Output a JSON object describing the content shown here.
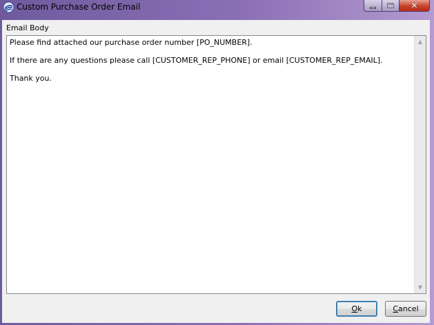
{
  "window": {
    "title": "Custom Purchase Order Email",
    "app_icon": "swirl-logo-icon",
    "minimize_icon": "minimize-icon",
    "maximize_icon": "maximize-icon",
    "close_icon": "close-icon",
    "close_glyph": "✕"
  },
  "email": {
    "label": "Email Body",
    "body": "Please find attached our purchase order number [PO_NUMBER].\n\nIf there are any questions please call [CUSTOMER_REP_PHONE] or email [CUSTOMER_REP_EMAIL].\n\nThank you."
  },
  "scrollbar": {
    "up_glyph": "▲",
    "down_glyph": "▼"
  },
  "buttons": {
    "ok_accel": "O",
    "ok_rest": "k",
    "cancel_accel": "C",
    "cancel_rest": "ancel"
  },
  "colors": {
    "title_bar": "#8a6fb5",
    "close_button": "#c7432b",
    "client_background": "#f0f0f0",
    "default_button_border": "#3c7fb1"
  }
}
